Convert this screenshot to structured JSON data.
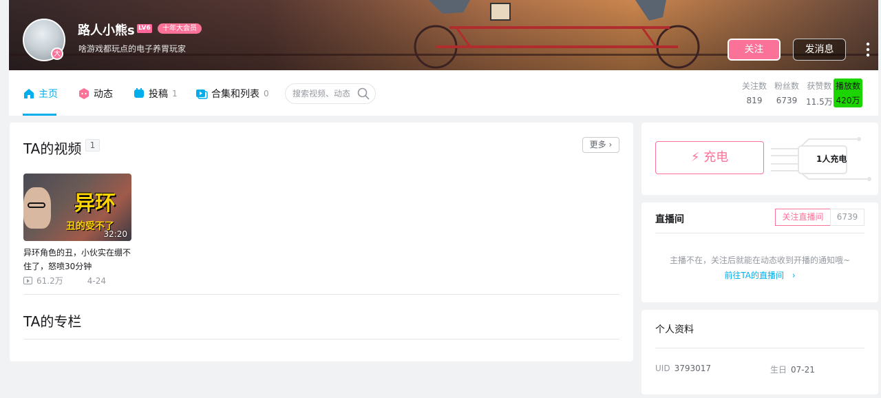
{
  "header": {
    "username": "路人小熊s",
    "level": "LV6",
    "vip_label": "十年大会员",
    "signature": "啥游戏都玩点的电子养胃玩家",
    "avatar_badge": "大",
    "follow_button": "关注",
    "message_button": "发消息",
    "more_menu": "⋮"
  },
  "nav": {
    "items": [
      {
        "label": "主页",
        "icon": "home-icon",
        "count": ""
      },
      {
        "label": "动态",
        "icon": "dynamic-icon",
        "count": ""
      },
      {
        "label": "投稿",
        "icon": "upload-icon",
        "count": "1"
      },
      {
        "label": "合集和列表",
        "icon": "collection-icon",
        "count": "0"
      }
    ],
    "search_placeholder": "搜索视频、动态"
  },
  "stats": [
    {
      "label": "关注数",
      "value": "819"
    },
    {
      "label": "粉丝数",
      "value": "6739"
    },
    {
      "label": "获赞数",
      "value": "11.5万"
    },
    {
      "label": "播放数",
      "value": "420万"
    }
  ],
  "videos_section": {
    "title": "TA的视频",
    "count": "1",
    "more": "更多",
    "videos": [
      {
        "thumb_big_text": "异环",
        "thumb_small_text": "丑的受不了",
        "duration": "32:20",
        "title": "异环角色的丑，小伙实在绷不住了，怒喷30分钟",
        "plays": "61.2万",
        "date": "4-24"
      }
    ]
  },
  "column_section": {
    "title": "TA的专栏"
  },
  "charge": {
    "button": "充电",
    "count_text": "1人充电"
  },
  "live": {
    "title": "直播间",
    "follow_button": "关注直播间",
    "follow_count": "6739",
    "message": "主播不在，关注后就能在动态收到开播的通知哦~",
    "link": "前往TA的直播间"
  },
  "profile": {
    "title": "个人资料",
    "uid_label": "UID",
    "uid": "3793017",
    "birthday_label": "生日",
    "birthday": "07-21"
  },
  "colors": {
    "accent": "#00aeec",
    "pink": "#fb7299",
    "highlight": "#1bd400"
  }
}
